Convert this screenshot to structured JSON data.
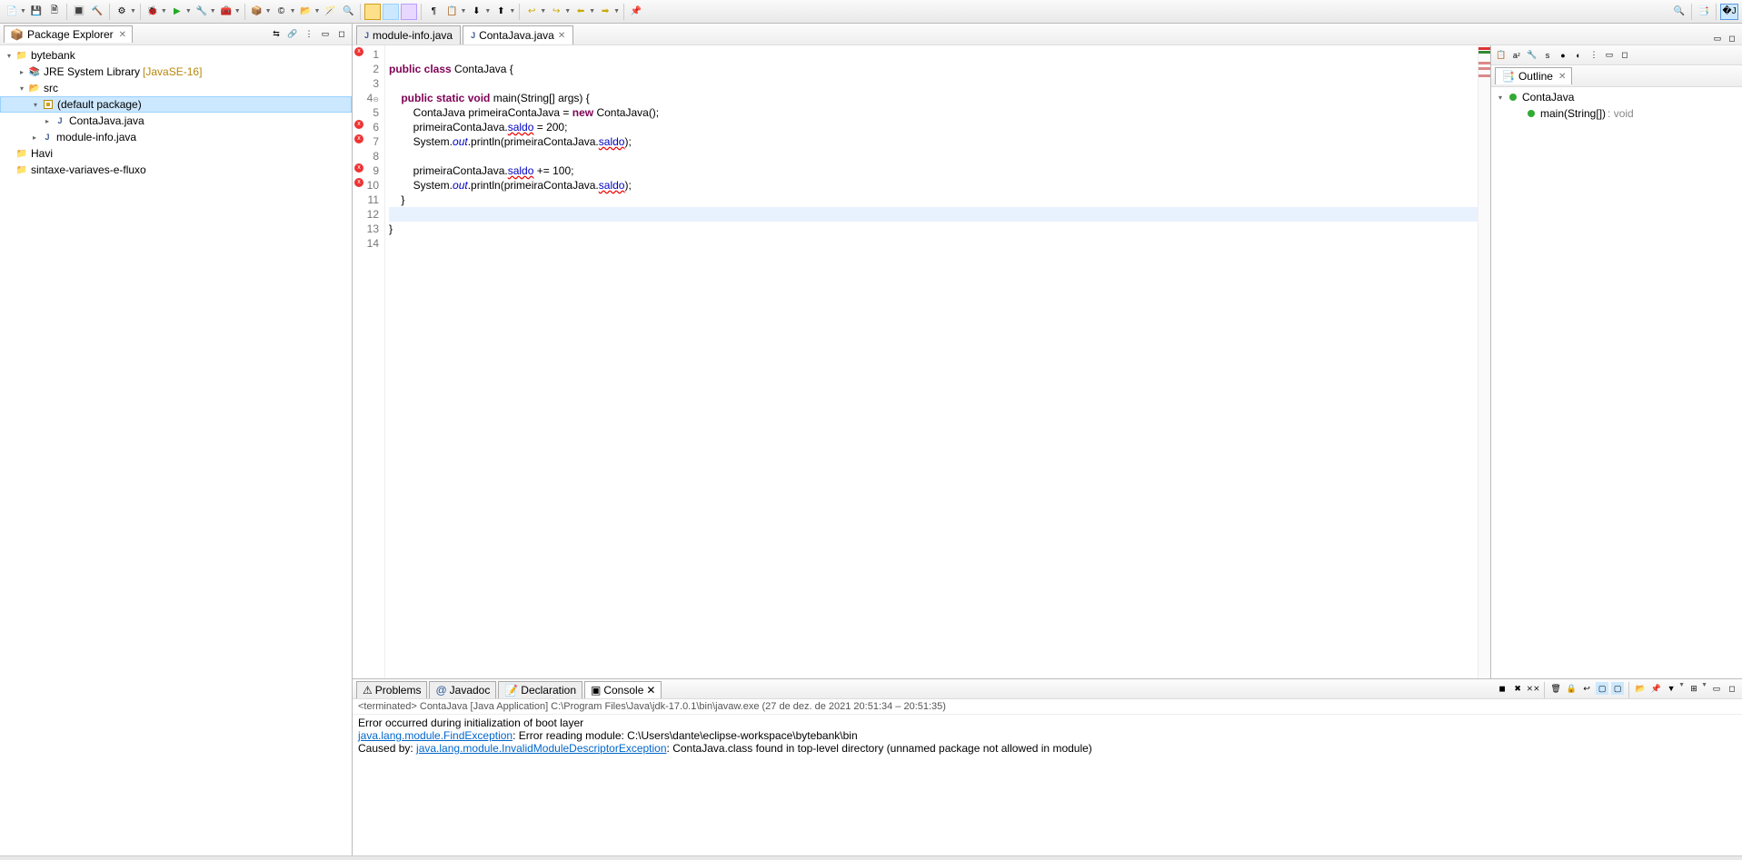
{
  "toolbar_icons": [
    "📄",
    "💾",
    "📑",
    "🖨",
    "🔨",
    "⚙",
    "🐞",
    "▶",
    "🔧",
    "🧪",
    "📦",
    "📁",
    "🔍",
    "📌",
    "⬅",
    "➡",
    "↩"
  ],
  "package_explorer": {
    "title": "Package Explorer",
    "tree": {
      "project": "bytebank",
      "jre": "JRE System Library",
      "jre_version": "[JavaSE-16]",
      "src": "src",
      "default_pkg": "(default package)",
      "file1": "ContaJava.java",
      "file2": "module-info.java",
      "proj2": "Havi",
      "proj3": "sintaxe-variaves-e-fluxo"
    }
  },
  "editor": {
    "tabs": [
      {
        "name": "module-info.java",
        "active": false
      },
      {
        "name": "ContaJava.java",
        "active": true
      }
    ],
    "line_numbers": [
      "1",
      "2",
      "3",
      "4",
      "5",
      "6",
      "7",
      "8",
      "9",
      "10",
      "11",
      "12",
      "13",
      "14"
    ],
    "error_lines": [
      1,
      6,
      7,
      9,
      10
    ],
    "fold_line": 4,
    "code": {
      "l2_p1": "public",
      "l2_p2": " class",
      "l2_p3": " ContaJava {",
      "l4_p1": "    public",
      "l4_p2": " static",
      "l4_p3": " void",
      "l4_p4": " main(String[] args) {",
      "l5_p1": "        ContaJava primeiraContaJava = ",
      "l5_p2": "new",
      "l5_p3": " ContaJava();",
      "l6_p1": "        primeiraContaJava.",
      "l6_p2": "saldo",
      "l6_p3": " = 200;",
      "l7_p1": "        System.",
      "l7_p2": "out",
      "l7_p3": ".println(primeiraContaJava.",
      "l7_p4": "saldo",
      "l7_p5": ");",
      "l9_p1": "        primeiraContaJava.",
      "l9_p2": "saldo",
      "l9_p3": " += 100;",
      "l10_p1": "        System.",
      "l10_p2": "out",
      "l10_p3": ".println(primeiraContaJava.",
      "l10_p4": "saldo",
      "l10_p5": ");",
      "l11": "    }",
      "l13": "}"
    }
  },
  "outline": {
    "title": "Outline",
    "root": "ContaJava",
    "method": "main(String[])",
    "return_type": ": void"
  },
  "bottom": {
    "tabs": {
      "problems": "Problems",
      "javadoc": "Javadoc",
      "declaration": "Declaration",
      "console": "Console"
    },
    "status": "<terminated> ContaJava [Java Application] C:\\Program Files\\Java\\jdk-17.0.1\\bin\\javaw.exe  (27 de dez. de 2021 20:51:34 – 20:51:35)",
    "line1": "Error occurred during initialization of boot layer",
    "line2_link": "java.lang.module.FindException",
    "line2_rest": ": Error reading module: C:\\Users\\dante\\eclipse-workspace\\bytebank\\bin",
    "line3_pre": "Caused by: ",
    "line3_link": "java.lang.module.InvalidModuleDescriptorException",
    "line3_rest": ": ContaJava.class found in top-level directory (unnamed package not allowed in module)"
  }
}
